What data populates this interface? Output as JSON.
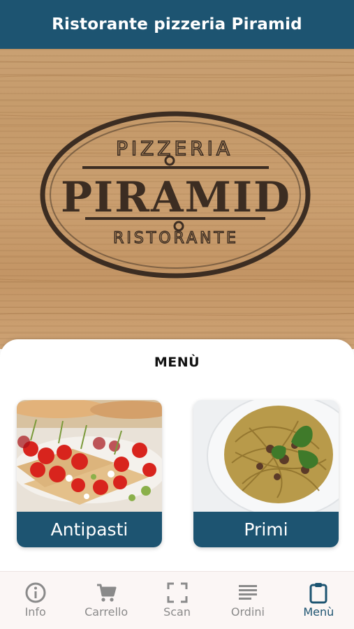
{
  "app_bar": {
    "title": "Ristorante pizzeria Piramid"
  },
  "logo": {
    "top_text": "PIZZERIA",
    "main_text": "PIRAMID",
    "bottom_text": "RISTORANTE"
  },
  "menu": {
    "title": "MENÙ",
    "categories": [
      {
        "label": "Antipasti",
        "image": "bruschetta-tomatoes-photo"
      },
      {
        "label": "Primi",
        "image": "spaghetti-bolognese-photo"
      }
    ]
  },
  "bottom_nav": {
    "items": [
      {
        "label": "Info",
        "icon": "info-icon",
        "active": false
      },
      {
        "label": "Carrello",
        "icon": "cart-icon",
        "active": false
      },
      {
        "label": "Scan",
        "icon": "scan-icon",
        "active": false
      },
      {
        "label": "Ordini",
        "icon": "list-icon",
        "active": false
      },
      {
        "label": "Menù",
        "icon": "clipboard-icon",
        "active": true
      }
    ]
  },
  "colors": {
    "primary": "#1d5471",
    "inactive": "#8a8a8a",
    "nav_bg": "#fbf6f5"
  }
}
